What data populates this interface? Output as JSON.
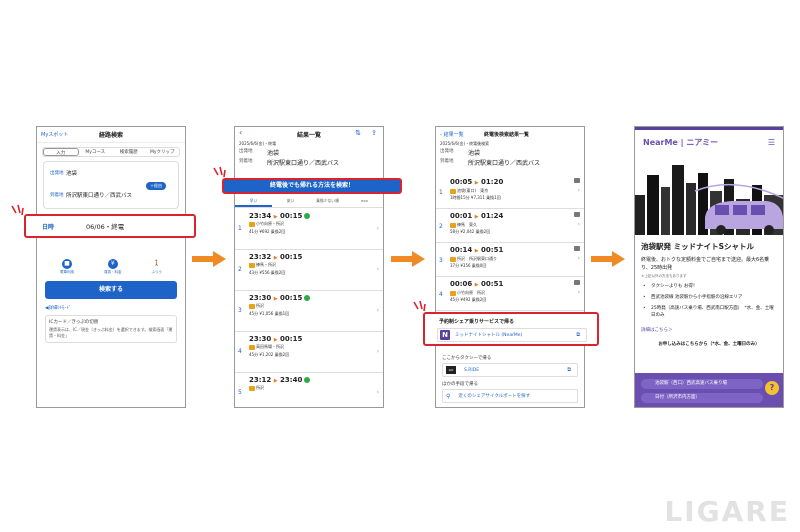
{
  "colors": {
    "accent": "#1e63c8",
    "highlight": "#d9242f",
    "arrow": "#f08a24",
    "nearme": "#5b3fa0"
  },
  "phone1": {
    "my_spot": "Myスポット",
    "title": "経路検索",
    "tabs": [
      "入力",
      "Myコース",
      "検索履歴",
      "Myクリップ"
    ],
    "from_label": "出発地",
    "from_value": "池袋",
    "to_label": "到着地",
    "to_value": "所沢駅東口通り／西武バス",
    "via_button": "＋経由",
    "date_label": "日時",
    "date_value": "06/06・終電",
    "modes": [
      {
        "icon": "bus-icon",
        "label": "電車利用"
      },
      {
        "icon": "yen-icon",
        "label": "運賃・料金"
      },
      {
        "icon": "walk-icon",
        "label": "ふつう"
      }
    ],
    "search_button": "検索する",
    "mode_link": "◀詳細ｼﾄﾓｰﾄﾞ",
    "ic_title": "ICカード／きっぷの切替",
    "ic_body": "運賃表示は、IC／現金（きっぷ料金）を選択できます。検索画面「運賃・料金」"
  },
  "phone2": {
    "title": "結果一覧",
    "date": "2025/6/6(金)・終電",
    "from_label": "出発地",
    "from_value": "池袋",
    "to_label": "到着地",
    "to_value": "所沢駅東口通り／西武バス",
    "search_banner": "終電後でも帰れる方法を検索！",
    "sort_tabs": [
      "早い",
      "安い",
      "乗換少ない順",
      "eco"
    ],
    "results": [
      {
        "num": "1",
        "dep": "23:34",
        "arr": "00:15",
        "line": "小竹向原・所沢",
        "meta": "41分 ¥692 乗換2回"
      },
      {
        "num": "2",
        "dep": "23:32",
        "arr": "00:15",
        "line": "練馬・所沢",
        "meta": "43分 ¥556 乗換2回"
      },
      {
        "num": "3",
        "dep": "23:30",
        "arr": "00:15",
        "line": "所沢",
        "meta": "45分 ¥1,056 乗換1回"
      },
      {
        "num": "4",
        "dep": "23:30",
        "arr": "00:15",
        "line": "高田馬場・所沢",
        "meta": "45分 ¥1,202 乗換2回"
      },
      {
        "num": "5",
        "dep": "23:12",
        "arr": "23:40",
        "line": "所沢",
        "meta": ""
      }
    ]
  },
  "phone3": {
    "back": "結果一覧",
    "title": "終電後検索結果一覧",
    "date": "2025/6/6(金)・終電後検索",
    "from_label": "出発地",
    "from_value": "池袋",
    "to_label": "到着地",
    "to_value": "所沢駅東口通り／西武バス",
    "results": [
      {
        "num": "1",
        "dep": "00:05",
        "arr": "01:20",
        "line": "池袋(東口)　東京",
        "meta": "1時間15分 ¥7,311 乗換1回"
      },
      {
        "num": "2",
        "dep": "00:01",
        "arr": "01:24",
        "line": "練馬　東久",
        "meta": "58分 ¥2,042 乗換2回"
      },
      {
        "num": "3",
        "dep": "00:14",
        "arr": "00:51",
        "line": "所沢　所沢駅東口通り",
        "meta": "37分 ¥356 乗換0回"
      },
      {
        "num": "4",
        "dep": "00:06",
        "arr": "00:51",
        "line": "小竹向原　所沢",
        "meta": "45分 ¥492 乗換2回"
      }
    ],
    "share_heading": "予約制シェア乗りサービスで帰る",
    "share_logo": "N",
    "share_link": "ミッドナイトシャトル (NearMe)",
    "taxi_heading": "ここからタクシーで帰る",
    "taxi_logo": "GO",
    "taxi_link": "S.RIDE",
    "cycle_heading": "ほかの手段で帰る",
    "cycle_link": "近くのシェアサイクルポートを探す"
  },
  "phone4": {
    "brand": "NearMe | ニアミー",
    "menu": "☰",
    "title": "池袋駅発 ミッドナイトSシャトル",
    "desc": "終電後、おトクな定額料金でご自宅まで送迎。最大6名乗り、25時出発",
    "note": "＊上記以外の方法もあります",
    "features": [
      "タクシーよりも お得！",
      "西武池袋線 池袋駅から小手指駅の沿線エリア",
      "25時発（高速バス乗り場、西武南口駅方面）　*水、金、土曜日のみ"
    ],
    "details_link": "詳細はこちら＞",
    "cta": "お申し込みはこちらから（*水、金、土曜日のみ）",
    "pill1": "池袋駅（西口）西武高速バス乗り場",
    "pill2": "日付（所沢市内方面）",
    "help": "?"
  },
  "watermark": "LIGARE"
}
